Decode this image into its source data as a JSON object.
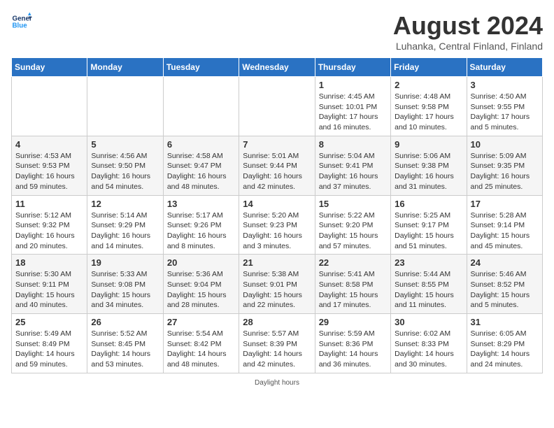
{
  "header": {
    "logo_line1": "General",
    "logo_line2": "Blue",
    "month_title": "August 2024",
    "location": "Luhanka, Central Finland, Finland"
  },
  "days_of_week": [
    "Sunday",
    "Monday",
    "Tuesday",
    "Wednesday",
    "Thursday",
    "Friday",
    "Saturday"
  ],
  "weeks": [
    [
      {
        "num": "",
        "sunrise": "",
        "sunset": "",
        "daylight": ""
      },
      {
        "num": "",
        "sunrise": "",
        "sunset": "",
        "daylight": ""
      },
      {
        "num": "",
        "sunrise": "",
        "sunset": "",
        "daylight": ""
      },
      {
        "num": "",
        "sunrise": "",
        "sunset": "",
        "daylight": ""
      },
      {
        "num": "1",
        "sunrise": "Sunrise: 4:45 AM",
        "sunset": "Sunset: 10:01 PM",
        "daylight": "Daylight: 17 hours and 16 minutes."
      },
      {
        "num": "2",
        "sunrise": "Sunrise: 4:48 AM",
        "sunset": "Sunset: 9:58 PM",
        "daylight": "Daylight: 17 hours and 10 minutes."
      },
      {
        "num": "3",
        "sunrise": "Sunrise: 4:50 AM",
        "sunset": "Sunset: 9:55 PM",
        "daylight": "Daylight: 17 hours and 5 minutes."
      }
    ],
    [
      {
        "num": "4",
        "sunrise": "Sunrise: 4:53 AM",
        "sunset": "Sunset: 9:53 PM",
        "daylight": "Daylight: 16 hours and 59 minutes."
      },
      {
        "num": "5",
        "sunrise": "Sunrise: 4:56 AM",
        "sunset": "Sunset: 9:50 PM",
        "daylight": "Daylight: 16 hours and 54 minutes."
      },
      {
        "num": "6",
        "sunrise": "Sunrise: 4:58 AM",
        "sunset": "Sunset: 9:47 PM",
        "daylight": "Daylight: 16 hours and 48 minutes."
      },
      {
        "num": "7",
        "sunrise": "Sunrise: 5:01 AM",
        "sunset": "Sunset: 9:44 PM",
        "daylight": "Daylight: 16 hours and 42 minutes."
      },
      {
        "num": "8",
        "sunrise": "Sunrise: 5:04 AM",
        "sunset": "Sunset: 9:41 PM",
        "daylight": "Daylight: 16 hours and 37 minutes."
      },
      {
        "num": "9",
        "sunrise": "Sunrise: 5:06 AM",
        "sunset": "Sunset: 9:38 PM",
        "daylight": "Daylight: 16 hours and 31 minutes."
      },
      {
        "num": "10",
        "sunrise": "Sunrise: 5:09 AM",
        "sunset": "Sunset: 9:35 PM",
        "daylight": "Daylight: 16 hours and 25 minutes."
      }
    ],
    [
      {
        "num": "11",
        "sunrise": "Sunrise: 5:12 AM",
        "sunset": "Sunset: 9:32 PM",
        "daylight": "Daylight: 16 hours and 20 minutes."
      },
      {
        "num": "12",
        "sunrise": "Sunrise: 5:14 AM",
        "sunset": "Sunset: 9:29 PM",
        "daylight": "Daylight: 16 hours and 14 minutes."
      },
      {
        "num": "13",
        "sunrise": "Sunrise: 5:17 AM",
        "sunset": "Sunset: 9:26 PM",
        "daylight": "Daylight: 16 hours and 8 minutes."
      },
      {
        "num": "14",
        "sunrise": "Sunrise: 5:20 AM",
        "sunset": "Sunset: 9:23 PM",
        "daylight": "Daylight: 16 hours and 3 minutes."
      },
      {
        "num": "15",
        "sunrise": "Sunrise: 5:22 AM",
        "sunset": "Sunset: 9:20 PM",
        "daylight": "Daylight: 15 hours and 57 minutes."
      },
      {
        "num": "16",
        "sunrise": "Sunrise: 5:25 AM",
        "sunset": "Sunset: 9:17 PM",
        "daylight": "Daylight: 15 hours and 51 minutes."
      },
      {
        "num": "17",
        "sunrise": "Sunrise: 5:28 AM",
        "sunset": "Sunset: 9:14 PM",
        "daylight": "Daylight: 15 hours and 45 minutes."
      }
    ],
    [
      {
        "num": "18",
        "sunrise": "Sunrise: 5:30 AM",
        "sunset": "Sunset: 9:11 PM",
        "daylight": "Daylight: 15 hours and 40 minutes."
      },
      {
        "num": "19",
        "sunrise": "Sunrise: 5:33 AM",
        "sunset": "Sunset: 9:08 PM",
        "daylight": "Daylight: 15 hours and 34 minutes."
      },
      {
        "num": "20",
        "sunrise": "Sunrise: 5:36 AM",
        "sunset": "Sunset: 9:04 PM",
        "daylight": "Daylight: 15 hours and 28 minutes."
      },
      {
        "num": "21",
        "sunrise": "Sunrise: 5:38 AM",
        "sunset": "Sunset: 9:01 PM",
        "daylight": "Daylight: 15 hours and 22 minutes."
      },
      {
        "num": "22",
        "sunrise": "Sunrise: 5:41 AM",
        "sunset": "Sunset: 8:58 PM",
        "daylight": "Daylight: 15 hours and 17 minutes."
      },
      {
        "num": "23",
        "sunrise": "Sunrise: 5:44 AM",
        "sunset": "Sunset: 8:55 PM",
        "daylight": "Daylight: 15 hours and 11 minutes."
      },
      {
        "num": "24",
        "sunrise": "Sunrise: 5:46 AM",
        "sunset": "Sunset: 8:52 PM",
        "daylight": "Daylight: 15 hours and 5 minutes."
      }
    ],
    [
      {
        "num": "25",
        "sunrise": "Sunrise: 5:49 AM",
        "sunset": "Sunset: 8:49 PM",
        "daylight": "Daylight: 14 hours and 59 minutes."
      },
      {
        "num": "26",
        "sunrise": "Sunrise: 5:52 AM",
        "sunset": "Sunset: 8:45 PM",
        "daylight": "Daylight: 14 hours and 53 minutes."
      },
      {
        "num": "27",
        "sunrise": "Sunrise: 5:54 AM",
        "sunset": "Sunset: 8:42 PM",
        "daylight": "Daylight: 14 hours and 48 minutes."
      },
      {
        "num": "28",
        "sunrise": "Sunrise: 5:57 AM",
        "sunset": "Sunset: 8:39 PM",
        "daylight": "Daylight: 14 hours and 42 minutes."
      },
      {
        "num": "29",
        "sunrise": "Sunrise: 5:59 AM",
        "sunset": "Sunset: 8:36 PM",
        "daylight": "Daylight: 14 hours and 36 minutes."
      },
      {
        "num": "30",
        "sunrise": "Sunrise: 6:02 AM",
        "sunset": "Sunset: 8:33 PM",
        "daylight": "Daylight: 14 hours and 30 minutes."
      },
      {
        "num": "31",
        "sunrise": "Sunrise: 6:05 AM",
        "sunset": "Sunset: 8:29 PM",
        "daylight": "Daylight: 14 hours and 24 minutes."
      }
    ]
  ],
  "footer": {
    "daylight_label": "Daylight hours"
  }
}
